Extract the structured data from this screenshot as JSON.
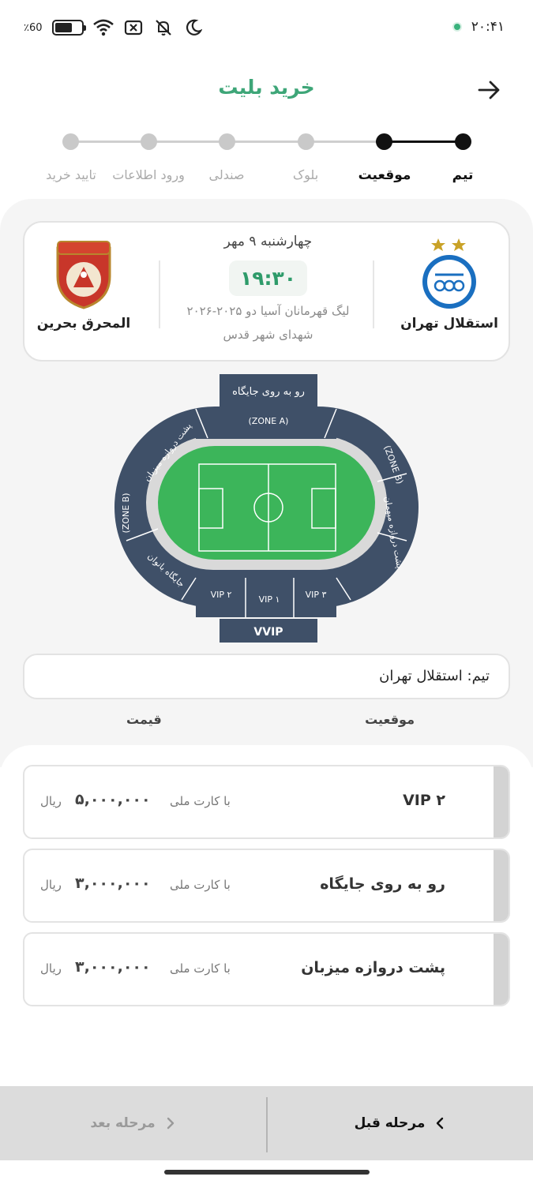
{
  "status_bar": {
    "battery_text": "٪60",
    "battery_level": 0.6,
    "time": "۲۰:۴۱",
    "icons": [
      "battery-icon",
      "wifi-icon",
      "no-sim-icon",
      "silent-icon",
      "moon-icon"
    ]
  },
  "header": {
    "title": "خرید بلیت"
  },
  "stepper": {
    "steps": [
      {
        "label": "تیم",
        "state": "done"
      },
      {
        "label": "موقعیت",
        "state": "active"
      },
      {
        "label": "بلوک",
        "state": "pending"
      },
      {
        "label": "صندلی",
        "state": "pending"
      },
      {
        "label": "ورود اطلاعات",
        "state": "pending"
      },
      {
        "label": "تایید خرید",
        "state": "pending"
      }
    ]
  },
  "match": {
    "home_team": "استقلال تهران",
    "away_team": "المحرق بحرین",
    "date": "چهارشنبه ۹ مهر",
    "time": "۱۹:۳۰",
    "league": "لیگ قهرمانان آسیا دو ۲۰۲۵-۲۰۲۶",
    "venue": "شهدای شهر قدس"
  },
  "stadium": {
    "top_stand": "رو به روی جایگاه",
    "zone_a": "(ZONE A)",
    "left_upper": "پشت دروازه میزبان",
    "left_zone": "(ZONE B)",
    "left_lower": "جایگاه بانوان",
    "right_zone": "(ZONE B)",
    "right_stand": "پشت دروازه میهمان",
    "vip2": "VIP ۲",
    "vip1": "VIP ۱",
    "vip3": "VIP ۳",
    "vvip": "VVIP"
  },
  "team_box": {
    "text": "تیم: استقلال تهران"
  },
  "columns": {
    "position": "موقعیت",
    "price": "قیمت"
  },
  "tickets": [
    {
      "name": "VIP ۲",
      "note": "با کارت ملی",
      "price": "۵,۰۰۰,۰۰۰",
      "currency": "ریال"
    },
    {
      "name": "رو به روی جایگاه",
      "note": "با کارت ملی",
      "price": "۳,۰۰۰,۰۰۰",
      "currency": "ریال"
    },
    {
      "name": "پشت دروازه میزبان",
      "note": "با کارت ملی",
      "price": "۳,۰۰۰,۰۰۰",
      "currency": "ریال"
    }
  ],
  "footer": {
    "prev_label": "مرحله قبل",
    "next_label": "مرحله بعد"
  },
  "colors": {
    "accent": "#3ea678",
    "pitch": "#3cb55a",
    "stand": "#3f5068"
  }
}
